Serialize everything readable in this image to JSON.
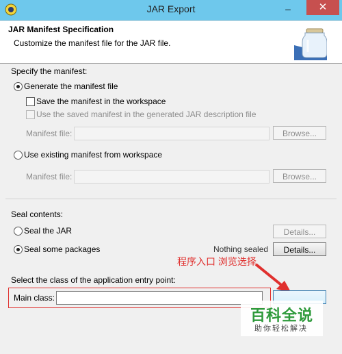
{
  "window": {
    "title": "JAR Export",
    "minimize": "–",
    "close": "✕"
  },
  "header": {
    "title": "JAR Manifest Specification",
    "description": "Customize the manifest file for the JAR file."
  },
  "manifest": {
    "section_label": "Specify the manifest:",
    "generate_label": "Generate the manifest file",
    "save_label": "Save the manifest in the workspace",
    "use_saved_label": "Use the saved manifest in the generated JAR description file",
    "manifest_file_label_1": "Manifest file:",
    "browse_label_1": "Browse...",
    "use_existing_label": "Use existing manifest from workspace",
    "manifest_file_label_2": "Manifest file:",
    "browse_label_2": "Browse..."
  },
  "seal": {
    "section_label": "Seal contents:",
    "seal_jar_label": "Seal the JAR",
    "details_label_1": "Details...",
    "seal_some_label": "Seal some packages",
    "status": "Nothing sealed",
    "details_label_2": "Details..."
  },
  "entry": {
    "section_label": "Select the class of the application entry point:",
    "main_class_label": "Main class:",
    "main_class_value": ""
  },
  "annotation": {
    "text": "程序入口 浏览选择"
  },
  "watermark": {
    "main": "百科全说",
    "sub": "助你轻松解决"
  },
  "colors": {
    "titlebar": "#6ec8ec",
    "annotation_red": "#e0302e",
    "watermark_green": "#2e9a3b",
    "close_button": "#c7504f"
  },
  "icons": [
    "app-icon",
    "jar-icon",
    "arrow-icon"
  ]
}
